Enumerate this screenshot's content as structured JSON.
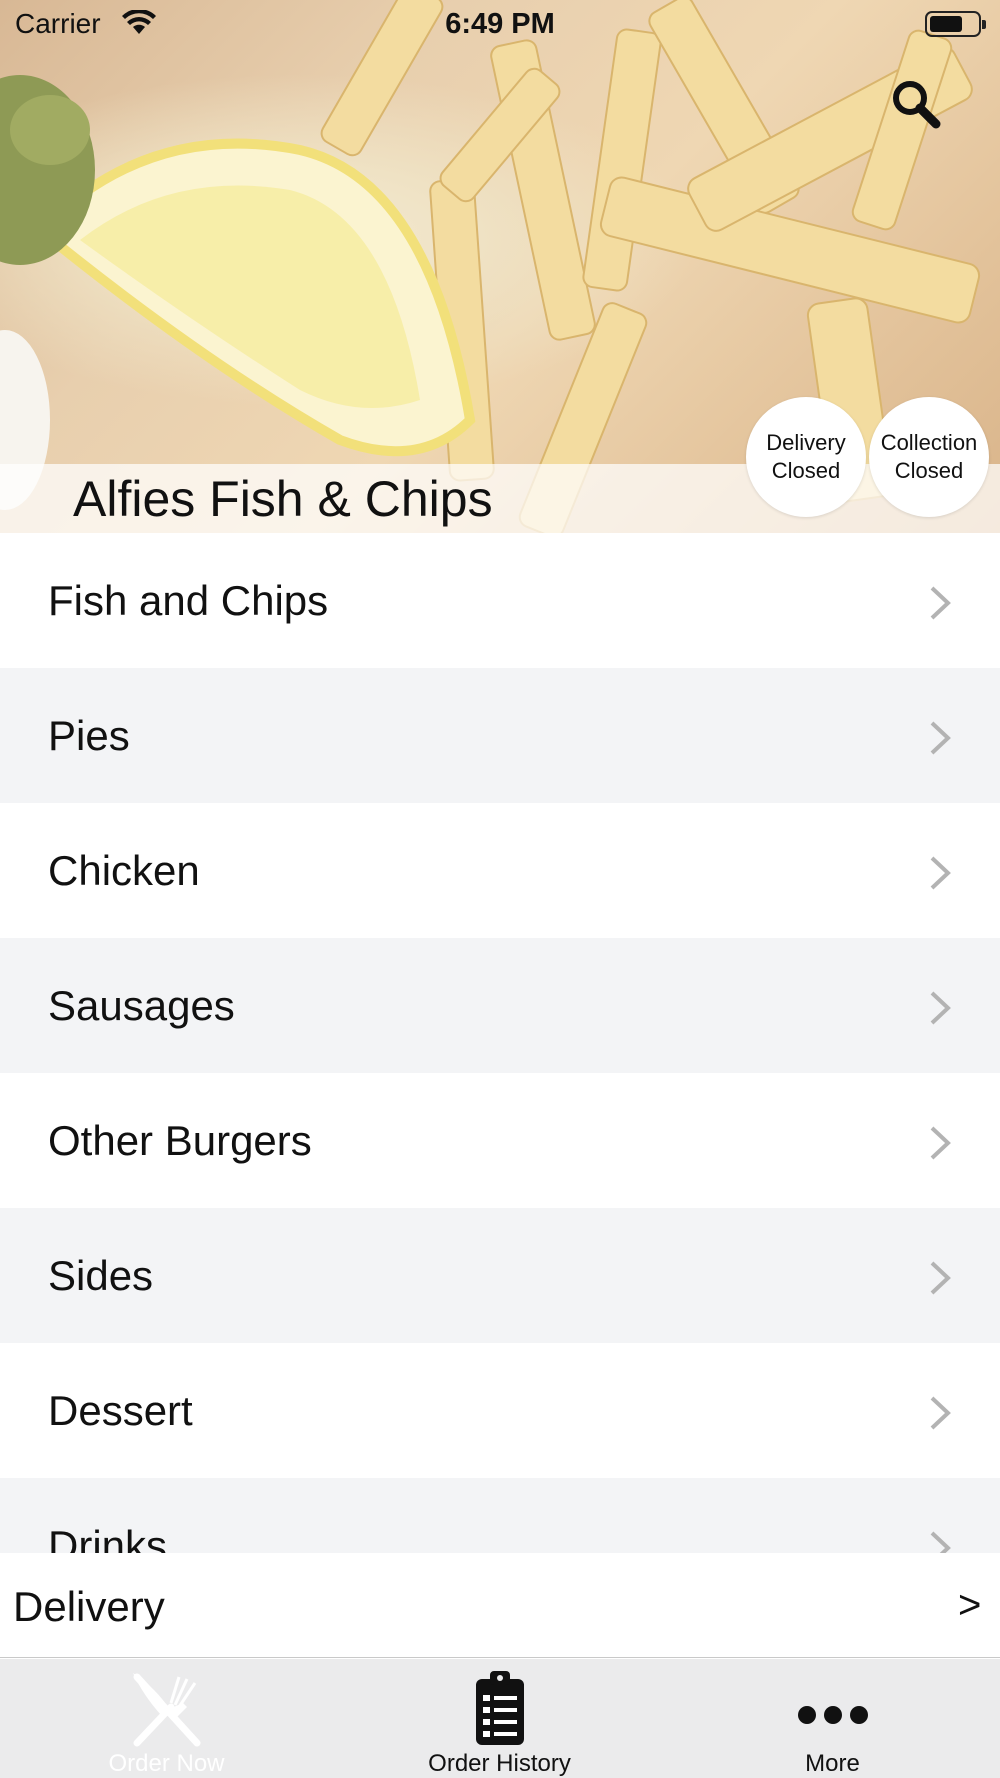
{
  "status_bar": {
    "carrier": "Carrier",
    "time": "6:49 PM",
    "battery_level": 0.7
  },
  "header": {
    "restaurant_name": "Alfies Fish & Chips",
    "search_icon": "search-icon",
    "delivery_status": {
      "line1": "Delivery",
      "line2": "Closed"
    },
    "collection_status": {
      "line1": "Collection",
      "line2": "Closed"
    }
  },
  "menu": {
    "categories": [
      {
        "label": "Fish and Chips"
      },
      {
        "label": "Pies"
      },
      {
        "label": "Chicken"
      },
      {
        "label": "Sausages"
      },
      {
        "label": "Other Burgers"
      },
      {
        "label": "Sides"
      },
      {
        "label": "Dessert"
      },
      {
        "label": "Drinks"
      }
    ],
    "chevron_icon": "chevron-right-icon"
  },
  "order_type": {
    "label": "Delivery",
    "arrow": ">"
  },
  "tab_bar": {
    "tabs": [
      {
        "label": "Order Now",
        "icon": "fork-knife-icon",
        "active": true
      },
      {
        "label": "Order History",
        "icon": "clipboard-icon",
        "active": false
      },
      {
        "label": "More",
        "icon": "more-dots-icon",
        "active": false
      }
    ]
  },
  "colors": {
    "row_alt": "#f3f4f6",
    "tab_bar_bg": "#ebebec",
    "active_tab_text": "#ffffff"
  }
}
